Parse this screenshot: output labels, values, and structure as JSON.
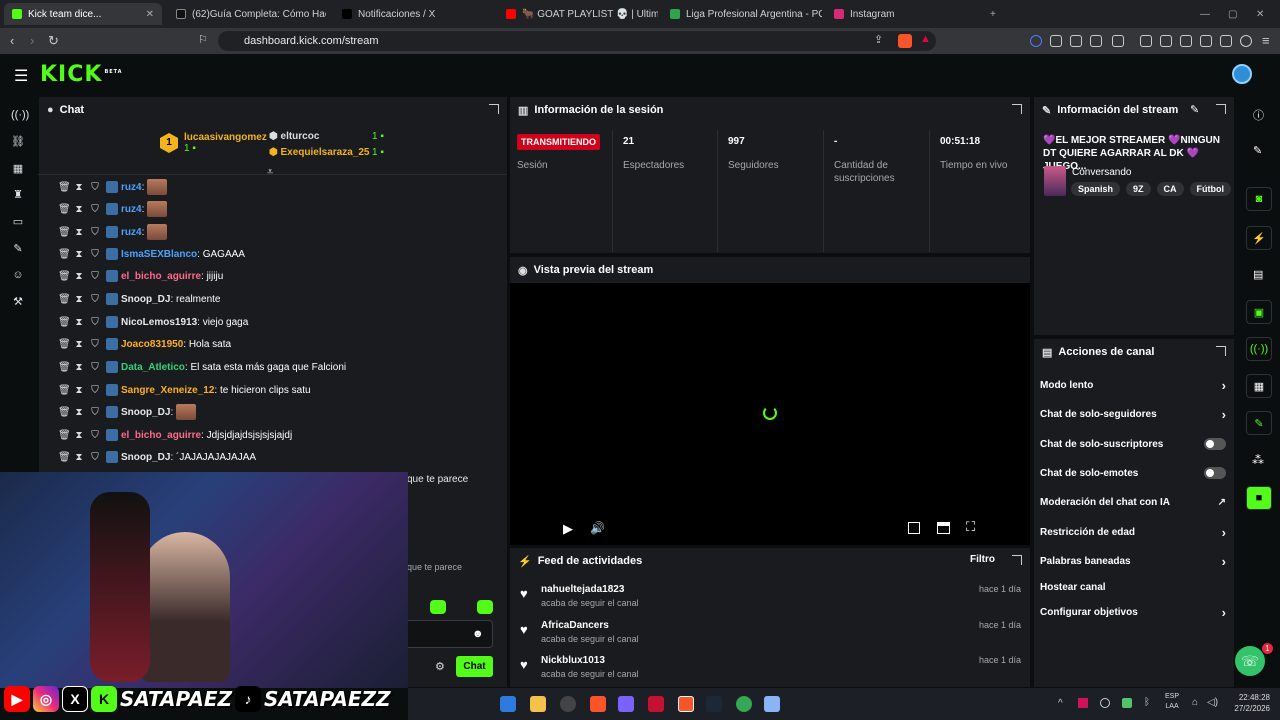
{
  "browser": {
    "tabs": [
      {
        "title": "Kick team dice...",
        "color": "#53fc18",
        "active": true
      },
      {
        "title": "(62)Guía Completa: Cómo Hacer Craf",
        "color": "#222"
      },
      {
        "title": "Notificaciones / X",
        "color": "#222"
      },
      {
        "title": "🐂 GOAT PLAYLIST 💀 | Ultimate Pho",
        "color": "#ff0000"
      },
      {
        "title": "Liga Profesional Argentina - POSICIO",
        "color": "#2da44e"
      },
      {
        "title": "Instagram",
        "color": "#d62976"
      }
    ],
    "url": "dashboard.kick.com/stream"
  },
  "header": {
    "logo": "KICK",
    "logo_tag": "BETA"
  },
  "chat": {
    "title": "Chat",
    "top_users": [
      {
        "rank": "1",
        "name": "lucaasivangomez",
        "count": "1"
      },
      {
        "name": "elturcoc",
        "count": "1"
      },
      {
        "name": "Exequielsaraza_25",
        "count": "1"
      }
    ],
    "messages": [
      {
        "user": "ruz4",
        "text": ":",
        "color": "#4aa3ff",
        "emote": true
      },
      {
        "user": "ruz4",
        "text": ":",
        "color": "#4aa3ff",
        "emote": true
      },
      {
        "user": "ruz4",
        "text": ":",
        "color": "#4aa3ff",
        "emote": true
      },
      {
        "user": "IsmaSEXBlanco",
        "text": ": GAGAAA",
        "color": "#4aa3ff"
      },
      {
        "user": "el_bicho_aguirre",
        "text": ": jijiju",
        "color": "#ff6b8a"
      },
      {
        "user": "Snoop_DJ",
        "text": ": realmente",
        "color": "#e8e8e8"
      },
      {
        "user": "NicoLemos1913",
        "text": ": viejo gaga",
        "color": "#e8e8e8"
      },
      {
        "user": "Joaco831950",
        "text": ": Hola sata",
        "color": "#ffb020"
      },
      {
        "user": "Data_Atletico",
        "text": ": El sata esta más gaga que Falcioni",
        "color": "#33d17a"
      },
      {
        "user": "Sangre_Xeneize_12",
        "text": ": te hicieron clips satu",
        "color": "#ffb020"
      },
      {
        "user": "Snoop_DJ",
        "text": ":",
        "color": "#e8e8e8",
        "emote": true
      },
      {
        "user": "el_bicho_aguirre",
        "text": ": Jdjsjdjajdsjsjsjsjajdj",
        "color": "#ff6b8a"
      },
      {
        "user": "Snoop_DJ",
        "text": ": ´JAJAJAJAJAJAA",
        "color": "#e8e8e8"
      }
    ],
    "partial_1": "que te parece",
    "partial_2": "que te parece",
    "chat_button": "Chat"
  },
  "session": {
    "title": "Información de la sesión",
    "live_badge": "TRANSMITIENDO",
    "session_label": "Sesión",
    "stats": [
      {
        "value": "21",
        "label": "Espectadores"
      },
      {
        "value": "997",
        "label": "Seguidores"
      },
      {
        "value": "-",
        "label": "Cantidad de suscripciones"
      },
      {
        "value": "00:51:18",
        "label": "Tiempo en vivo"
      }
    ]
  },
  "preview": {
    "title": "Vista previa del stream"
  },
  "stream_info": {
    "title": "Información del stream",
    "stream_title": "💜EL MEJOR STREAMER 💜NINGUN DT QUIERE AGARRAR AL DK 💜JUEGO...",
    "category": "Conversando",
    "tags": [
      "Spanish",
      "9Z",
      "CA",
      "Fútbol"
    ]
  },
  "channel_actions": {
    "title": "Acciones de canal",
    "items": [
      {
        "label": "Modo lento",
        "kind": "chevron"
      },
      {
        "label": "Chat de solo-seguidores",
        "kind": "chevron"
      },
      {
        "label": "Chat de solo-suscriptores",
        "kind": "toggle"
      },
      {
        "label": "Chat de solo-emotes",
        "kind": "toggle"
      },
      {
        "label": "Moderación del chat con IA",
        "kind": "external"
      },
      {
        "label": "Restricción de edad",
        "kind": "chevron"
      },
      {
        "label": "Palabras baneadas",
        "kind": "chevron"
      },
      {
        "label": "Hostear canal",
        "kind": "none"
      },
      {
        "label": "Configurar objetivos",
        "kind": "chevron"
      }
    ]
  },
  "activity": {
    "title": "Feed de actividades",
    "filter": "Filtro",
    "items": [
      {
        "name": "nahueltejada1823",
        "action": "acaba de seguir el canal",
        "time": "hace 1 día"
      },
      {
        "name": "AfricaDancers",
        "action": "acaba de seguir el canal",
        "time": "hace 1 día"
      },
      {
        "name": "Nickblux1013",
        "action": "acaba de seguir el canal",
        "time": "hace 1 día"
      }
    ]
  },
  "support_badge": "1",
  "overlay": {
    "handle_1": "SATAPAEZ",
    "handle_2": "SATAPAEZZ"
  },
  "taskbar": {
    "lang": "ESP",
    "lang2": "LAA",
    "time": "22:48:28",
    "date": "27/2/2026"
  }
}
